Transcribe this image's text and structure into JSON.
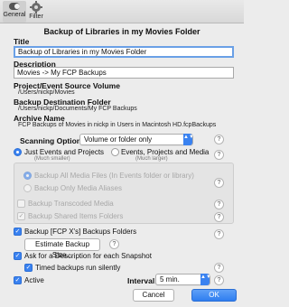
{
  "toolbar": {
    "general_label": "General",
    "filter_label": "Filter"
  },
  "window": {
    "title": "Backup of Libraries in my Movies Folder"
  },
  "fields": {
    "title_label": "Title",
    "title_value": "Backup of Libraries in my Movies Folder",
    "description_label": "Description",
    "description_value": "Movies -> My FCP Backups",
    "source_label": "Project/Event Source Volume",
    "source_value": "/Users/nickp/Movies",
    "destination_label": "Backup Destination Folder",
    "destination_value": "/Users/nickp/Documents/My FCP Backups",
    "archive_label": "Archive Name",
    "archive_value": "FCP Backups of Movies in nickp in Users in Macintosh HD.fcpBackups"
  },
  "scanning": {
    "label": "Scanning Options:",
    "selected": "Volume or folder only"
  },
  "mode": {
    "just_events": "Just Events and Projects",
    "just_events_sub": "(Much smaller)",
    "events_projects_media": "Events, Projects and Media",
    "events_projects_media_sub": "(Much larger)"
  },
  "media_options": {
    "backup_all_media": "Backup All Media Files (In Events folder or library)",
    "backup_only_aliases": "Backup Only Media Aliases",
    "backup_transcoded": "Backup Transcoded Media",
    "backup_shared": "Backup Shared Items Folders"
  },
  "options": {
    "backup_fcpx_folders": "Backup [FCP X's] Backups Folders",
    "estimate_button": "Estimate Backup Size...",
    "ask_description": "Ask for a Description for each Snapshot",
    "timed_silently": "Timed backups run silently",
    "active": "Active",
    "interval_label": "Interval:",
    "interval_value": "5 min."
  },
  "buttons": {
    "cancel": "Cancel",
    "ok": "OK"
  },
  "glyphs": {
    "help": "?",
    "check": "✓",
    "select_arrows": "▲▼"
  },
  "colors": {
    "accent": "#3a82f0",
    "focus_ring": "#6aa0e6"
  }
}
